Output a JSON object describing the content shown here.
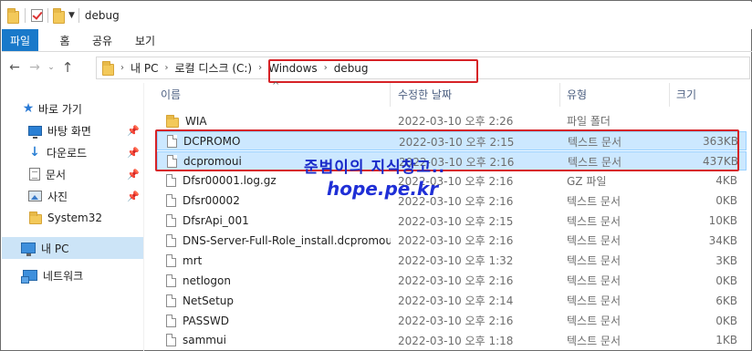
{
  "window": {
    "title": "debug"
  },
  "ribbon": {
    "tabs": [
      "파일",
      "홈",
      "공유",
      "보기"
    ]
  },
  "address": {
    "breadcrumbs": [
      "내 PC",
      "로컬 디스크 (C:)",
      "Windows",
      "debug"
    ]
  },
  "sidebar": {
    "quick_access": "바로 가기",
    "items": [
      {
        "label": "바탕 화면",
        "icon": "desktop-icon",
        "pinned": true
      },
      {
        "label": "다운로드",
        "icon": "download-icon",
        "pinned": true
      },
      {
        "label": "문서",
        "icon": "documents-icon",
        "pinned": true
      },
      {
        "label": "사진",
        "icon": "pictures-icon",
        "pinned": true
      },
      {
        "label": "System32",
        "icon": "folder-icon",
        "pinned": false
      }
    ],
    "this_pc": "내 PC",
    "network": "네트워크"
  },
  "columns": {
    "name": "이름",
    "date": "수정한 날짜",
    "type": "유형",
    "size": "크기"
  },
  "files": [
    {
      "name": "WIA",
      "date": "2022-03-10 오후 2:26",
      "type": "파일 폴더",
      "size": "",
      "icon": "folder-icon",
      "selected": false
    },
    {
      "name": "DCPROMO",
      "date": "2022-03-10 오후 2:15",
      "type": "텍스트 문서",
      "size": "363KB",
      "icon": "file-icon",
      "selected": true
    },
    {
      "name": "dcpromoui",
      "date": "2022-03-10 오후 2:16",
      "type": "텍스트 문서",
      "size": "437KB",
      "icon": "file-icon",
      "selected": true
    },
    {
      "name": "Dfsr00001.log.gz",
      "date": "2022-03-10 오후 2:16",
      "type": "GZ 파일",
      "size": "4KB",
      "icon": "file-icon",
      "selected": false
    },
    {
      "name": "Dfsr00002",
      "date": "2022-03-10 오후 2:16",
      "type": "텍스트 문서",
      "size": "0KB",
      "icon": "file-icon",
      "selected": false
    },
    {
      "name": "DfsrApi_001",
      "date": "2022-03-10 오후 2:15",
      "type": "텍스트 문서",
      "size": "10KB",
      "icon": "file-icon",
      "selected": false
    },
    {
      "name": "DNS-Server-Full-Role_install.dcpromoui",
      "date": "2022-03-10 오후 2:16",
      "type": "텍스트 문서",
      "size": "34KB",
      "icon": "file-icon",
      "selected": false
    },
    {
      "name": "mrt",
      "date": "2022-03-10 오후 1:32",
      "type": "텍스트 문서",
      "size": "3KB",
      "icon": "file-icon",
      "selected": false
    },
    {
      "name": "netlogon",
      "date": "2022-03-10 오후 2:16",
      "type": "텍스트 문서",
      "size": "0KB",
      "icon": "file-icon",
      "selected": false
    },
    {
      "name": "NetSetup",
      "date": "2022-03-10 오후 2:14",
      "type": "텍스트 문서",
      "size": "6KB",
      "icon": "file-icon",
      "selected": false
    },
    {
      "name": "PASSWD",
      "date": "2022-03-10 오후 2:16",
      "type": "텍스트 문서",
      "size": "0KB",
      "icon": "file-icon",
      "selected": false
    },
    {
      "name": "sammui",
      "date": "2022-03-10 오후 1:18",
      "type": "텍스트 문서",
      "size": "1KB",
      "icon": "file-icon",
      "selected": false
    }
  ],
  "watermark": {
    "line1": "준범이의 지식창고..",
    "line2": "hope.pe.kr"
  },
  "colors": {
    "accent": "#1979ca",
    "highlight_border": "#d62226",
    "selection": "#cce8ff",
    "watermark": "#1a2bc9"
  }
}
